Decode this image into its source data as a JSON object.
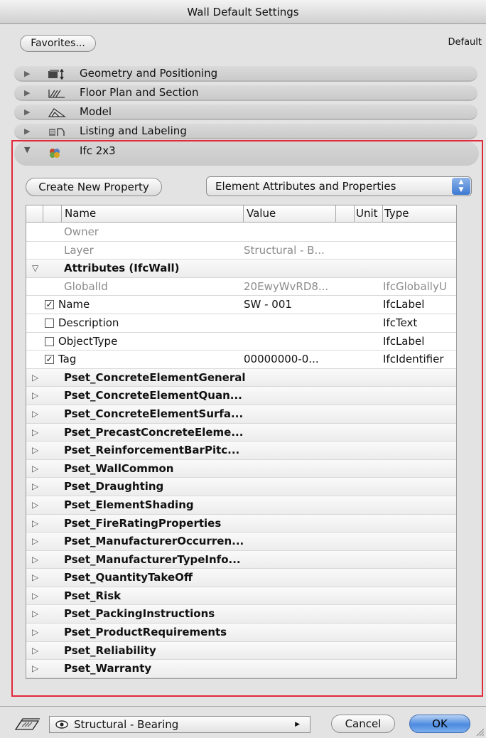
{
  "window": {
    "title": "Wall Default Settings"
  },
  "toolbar": {
    "favorites_label": "Favorites...",
    "default_label": "Default"
  },
  "sections": [
    {
      "label": "Geometry and Positioning",
      "icon": "geometry-icon",
      "expanded": false
    },
    {
      "label": "Floor Plan and Section",
      "icon": "floor-plan-icon",
      "expanded": false
    },
    {
      "label": "Model",
      "icon": "model-icon",
      "expanded": false
    },
    {
      "label": "Listing and Labeling",
      "icon": "listing-icon",
      "expanded": false
    },
    {
      "label": "Ifc 2x3",
      "icon": "ifc-icon",
      "expanded": true
    }
  ],
  "ifc": {
    "create_button_label": "Create New Property",
    "view_select_value": "Element Attributes and Properties",
    "columns": {
      "name": "Name",
      "value": "Value",
      "unit": "Unit",
      "type": "Type"
    },
    "rows": [
      {
        "kind": "plain",
        "name": "Owner",
        "value": "",
        "type": "",
        "dim": true
      },
      {
        "kind": "plain",
        "name": "Layer",
        "value": "Structural - B...",
        "type": "",
        "dim": true
      },
      {
        "kind": "group",
        "name": "Attributes (IfcWall)",
        "expanded": true
      },
      {
        "kind": "plain",
        "name": "GlobalId",
        "value": "20EwyWvRD8...",
        "type": "IfcGloballyU",
        "dim": true
      },
      {
        "kind": "check",
        "checked": true,
        "name": "Name",
        "value": "SW - 001",
        "type": "IfcLabel"
      },
      {
        "kind": "check",
        "checked": false,
        "name": "Description",
        "value": "",
        "type": "IfcText"
      },
      {
        "kind": "check",
        "checked": false,
        "name": "ObjectType",
        "value": "",
        "type": "IfcLabel"
      },
      {
        "kind": "check",
        "checked": true,
        "name": "Tag",
        "value": "00000000-0...",
        "type": "IfcIdentifier"
      },
      {
        "kind": "group",
        "name": "Pset_ConcreteElementGeneral",
        "expanded": false
      },
      {
        "kind": "group",
        "name": "Pset_ConcreteElementQuan...",
        "expanded": false
      },
      {
        "kind": "group",
        "name": "Pset_ConcreteElementSurfa...",
        "expanded": false
      },
      {
        "kind": "group",
        "name": "Pset_PrecastConcreteEleme...",
        "expanded": false
      },
      {
        "kind": "group",
        "name": "Pset_ReinforcementBarPitc...",
        "expanded": false
      },
      {
        "kind": "group",
        "name": "Pset_WallCommon",
        "expanded": false
      },
      {
        "kind": "group",
        "name": "Pset_Draughting",
        "expanded": false
      },
      {
        "kind": "group",
        "name": "Pset_ElementShading",
        "expanded": false
      },
      {
        "kind": "group",
        "name": "Pset_FireRatingProperties",
        "expanded": false
      },
      {
        "kind": "group",
        "name": "Pset_ManufacturerOccurren...",
        "expanded": false
      },
      {
        "kind": "group",
        "name": "Pset_ManufacturerTypeInfo...",
        "expanded": false
      },
      {
        "kind": "group",
        "name": "Pset_QuantityTakeOff",
        "expanded": false
      },
      {
        "kind": "group",
        "name": "Pset_Risk",
        "expanded": false
      },
      {
        "kind": "group",
        "name": "Pset_PackingInstructions",
        "expanded": false
      },
      {
        "kind": "group",
        "name": "Pset_ProductRequirements",
        "expanded": false
      },
      {
        "kind": "group",
        "name": "Pset_Reliability",
        "expanded": false
      },
      {
        "kind": "group",
        "name": "Pset_Warranty",
        "expanded": false
      }
    ]
  },
  "footer": {
    "layer_value": "Structural - Bearing",
    "cancel_label": "Cancel",
    "ok_label": "OK"
  },
  "colors": {
    "highlight_frame": "#e2293c",
    "default_button": "#4c8ae0"
  }
}
